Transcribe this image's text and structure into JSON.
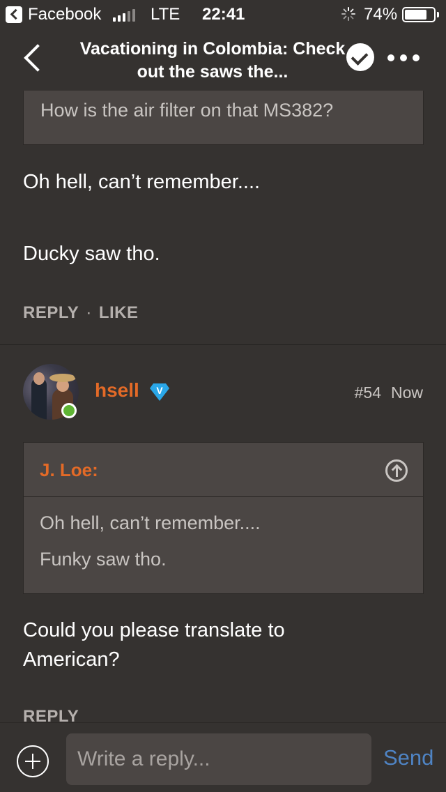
{
  "status_bar": {
    "app": "Facebook",
    "network": "LTE",
    "time": "22:41",
    "battery": "74%"
  },
  "nav": {
    "title": "Vacationing in Colombia: Check out the saws the..."
  },
  "thread": {
    "prev_quote": "How is the air filter on that MS382?",
    "prev_post": {
      "line1": "Oh hell, can’t remember....",
      "line2": "Ducky saw tho.",
      "reply_label": "REPLY",
      "separator": "·",
      "like_label": "LIKE"
    },
    "post": {
      "username": "hsell",
      "badge": "V",
      "number": "#54",
      "time": "Now",
      "quote_author": "J. Loe:",
      "quote_line1": "Oh hell, can’t remember....",
      "quote_line2": "Funky saw tho.",
      "body": "Could you please translate to American?",
      "reply_label": "REPLY"
    }
  },
  "reply_bar": {
    "placeholder": "Write a reply...",
    "send_label": "Send"
  },
  "colors": {
    "background": "#353230",
    "panel": "#4b4644",
    "accent_orange": "#e36a27",
    "link_blue": "#4f84c4",
    "online_green": "#5fb434",
    "badge_blue": "#2aa7e8"
  }
}
